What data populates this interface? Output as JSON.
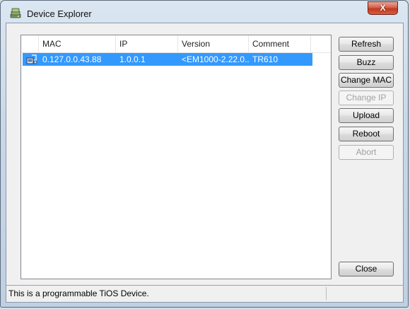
{
  "window": {
    "title": "Device Explorer",
    "close_glyph": "X"
  },
  "device_list": {
    "columns": [
      "MAC",
      "IP",
      "Version",
      "Comment"
    ],
    "rows": [
      {
        "icon": "device-icon",
        "mac": "0.127.0.0.43.88",
        "ip": "1.0.0.1",
        "version": "<EM1000-2.22.0...",
        "comment": "TR610",
        "selected": true
      }
    ]
  },
  "buttons": {
    "refresh": "Refresh",
    "buzz": "Buzz",
    "change_mac": "Change MAC",
    "change_ip": "Change IP",
    "upload": "Upload",
    "reboot": "Reboot",
    "abort": "Abort",
    "close": "Close"
  },
  "status_bar": {
    "text": "This is a programmable TiOS Device."
  },
  "colors": {
    "selection": "#3399ff",
    "disabled_text": "#a0a0a0"
  }
}
